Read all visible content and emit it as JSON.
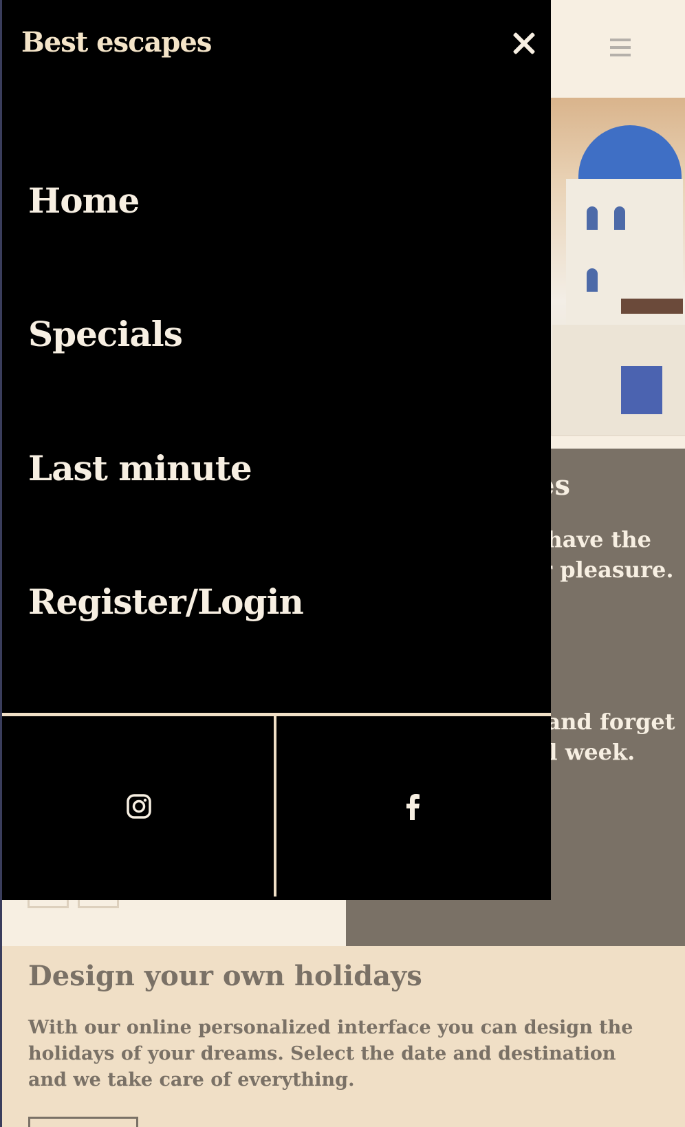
{
  "brand": "Best escapes",
  "nav": {
    "items": [
      {
        "label": "Home"
      },
      {
        "label": "Specials"
      },
      {
        "label": "Last minute"
      },
      {
        "label": "Register/Login"
      }
    ]
  },
  "social": {
    "items": [
      {
        "icon": "instagram-icon"
      },
      {
        "icon": "facebook-icon"
      }
    ]
  },
  "background": {
    "section_title_fragment": "es",
    "text_fragment_1": "e have the",
    "text_fragment_2": "ur pleasure.",
    "text_fragment_3": "e and forget",
    "text_fragment_4": "ull week.",
    "design_title": "Design your own holidays",
    "design_text": "With our online personalized interface you can design the holidays of your dreams. Select the date and destination and we take care of everything."
  },
  "colors": {
    "drawer_bg": "#000000",
    "cream": "#f7efe2",
    "taupe": "#7a7166",
    "sand": "#f0dfc6"
  }
}
